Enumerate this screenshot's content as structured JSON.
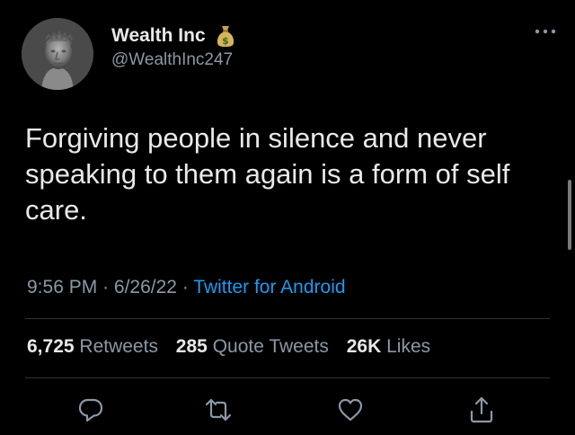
{
  "author": {
    "display_name": "Wealth Inc",
    "handle": "@WealthInc247",
    "badge_icon": "moneybag-icon"
  },
  "tweet": {
    "text": "Forgiving people in silence and never speaking to them again is a form of self care.",
    "time": "9:56 PM",
    "date": "6/26/22",
    "source": "Twitter for Android",
    "separator": "·"
  },
  "stats": {
    "retweets_count": "6,725",
    "retweets_label": "Retweets",
    "quotes_count": "285",
    "quotes_label": "Quote Tweets",
    "likes_count": "26K",
    "likes_label": "Likes"
  },
  "actions": [
    "reply-icon",
    "retweet-icon",
    "like-icon",
    "share-icon"
  ],
  "colors": {
    "background": "#000000",
    "text": "#e7e9ea",
    "muted": "#8b98a5",
    "link": "#1d9bf0",
    "divider": "#2f3336"
  }
}
